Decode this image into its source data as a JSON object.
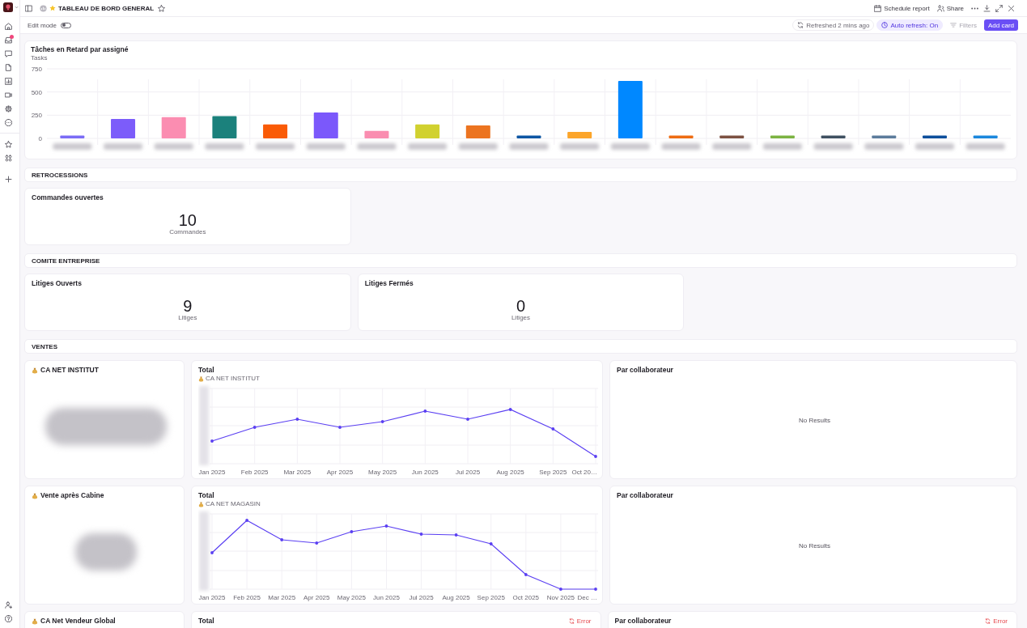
{
  "sidebar": {
    "inbox_badge": true
  },
  "topbar": {
    "title": "TABLEAU DE BORD GENERAL",
    "favorite": false,
    "actions": [
      "Schedule report",
      "Share"
    ]
  },
  "toolbar": {
    "edit_mode": {
      "label": "Edit mode",
      "on": false
    },
    "refreshed": "Refreshed 2 mins ago",
    "auto_refresh": {
      "label": "Auto refresh: On",
      "on": true
    },
    "filters": {
      "label": "Filters",
      "disabled": true
    },
    "add_card": "Add card"
  },
  "chart_card": {
    "title": "Tâches en Retard par assigné",
    "chart_data": {
      "type": "bar",
      "ylabel": "Tasks",
      "values": [
        30,
        210,
        230,
        240,
        150,
        280,
        80,
        150,
        140,
        30,
        70,
        620,
        30,
        30,
        30,
        30,
        30,
        30,
        30
      ],
      "colors": [
        "#7b6cf6",
        "#7c5cfa",
        "#fb8db1",
        "#1b817c",
        "#fa5b06",
        "#7b58fb",
        "#fa8db0",
        "#d1d12f",
        "#ec7420",
        "#0d56a3",
        "#fca52a",
        "#0088ff",
        "#ee6c12",
        "#7d5242",
        "#7cb342",
        "#3f5161",
        "#5c7c9c",
        "#0c4f9c",
        "#1b88dd"
      ],
      "ylim": [
        0,
        750
      ],
      "yticks": [
        0,
        250,
        500,
        750
      ]
    }
  },
  "sections": [
    {
      "title": "RETROCESSIONS",
      "rows": [
        [
          {
            "kind": "number",
            "title": "Commandes ouvertes",
            "value": "10",
            "unit": "Commandes"
          }
        ]
      ]
    },
    {
      "title": "COMITE ENTREPRISE",
      "rows": [
        [
          {
            "kind": "number",
            "title": "Litiges Ouverts",
            "value": "9",
            "unit": "Litiges"
          },
          {
            "kind": "number",
            "title": "Litiges Fermés",
            "value": "0",
            "unit": "Litiges"
          }
        ]
      ]
    },
    {
      "title": "VENTES",
      "rows": [
        [
          {
            "kind": "blurred",
            "title": "CA NET INSTITUT"
          },
          {
            "kind": "line",
            "title": "Total",
            "subtitle": "CA NET INSTITUT",
            "x_labels": [
              "Jan 2025",
              "Feb 2025",
              "Mar 2025",
              "Apr 2025",
              "May 2025",
              "Jun 2025",
              "Jul 2025",
              "Aug 2025",
              "Sep 2025",
              "Oct 20…"
            ]
          },
          {
            "kind": "empty",
            "title": "Par collaborateur",
            "message": "No Results"
          }
        ],
        [
          {
            "kind": "blurred",
            "title": "Vente après Cabine"
          },
          {
            "kind": "line",
            "title": "Total",
            "subtitle": "CA NET MAGASIN",
            "x_labels": [
              "Jan 2025",
              "Feb 2025",
              "Mar 2025",
              "Apr 2025",
              "May 2025",
              "Jun 2025",
              "Jul 2025",
              "Aug 2025",
              "Sep 2025",
              "Oct 2025",
              "Nov 2025",
              "Dec …"
            ]
          },
          {
            "kind": "empty",
            "title": "Par collaborateur",
            "message": "No Results"
          }
        ],
        [
          {
            "kind": "blurred",
            "title": "CA Net Vendeur Global"
          },
          {
            "kind": "error",
            "title": "Total",
            "error": "Error"
          },
          {
            "kind": "error",
            "title": "Par collaborateur",
            "error": "Error"
          }
        ]
      ]
    }
  ]
}
